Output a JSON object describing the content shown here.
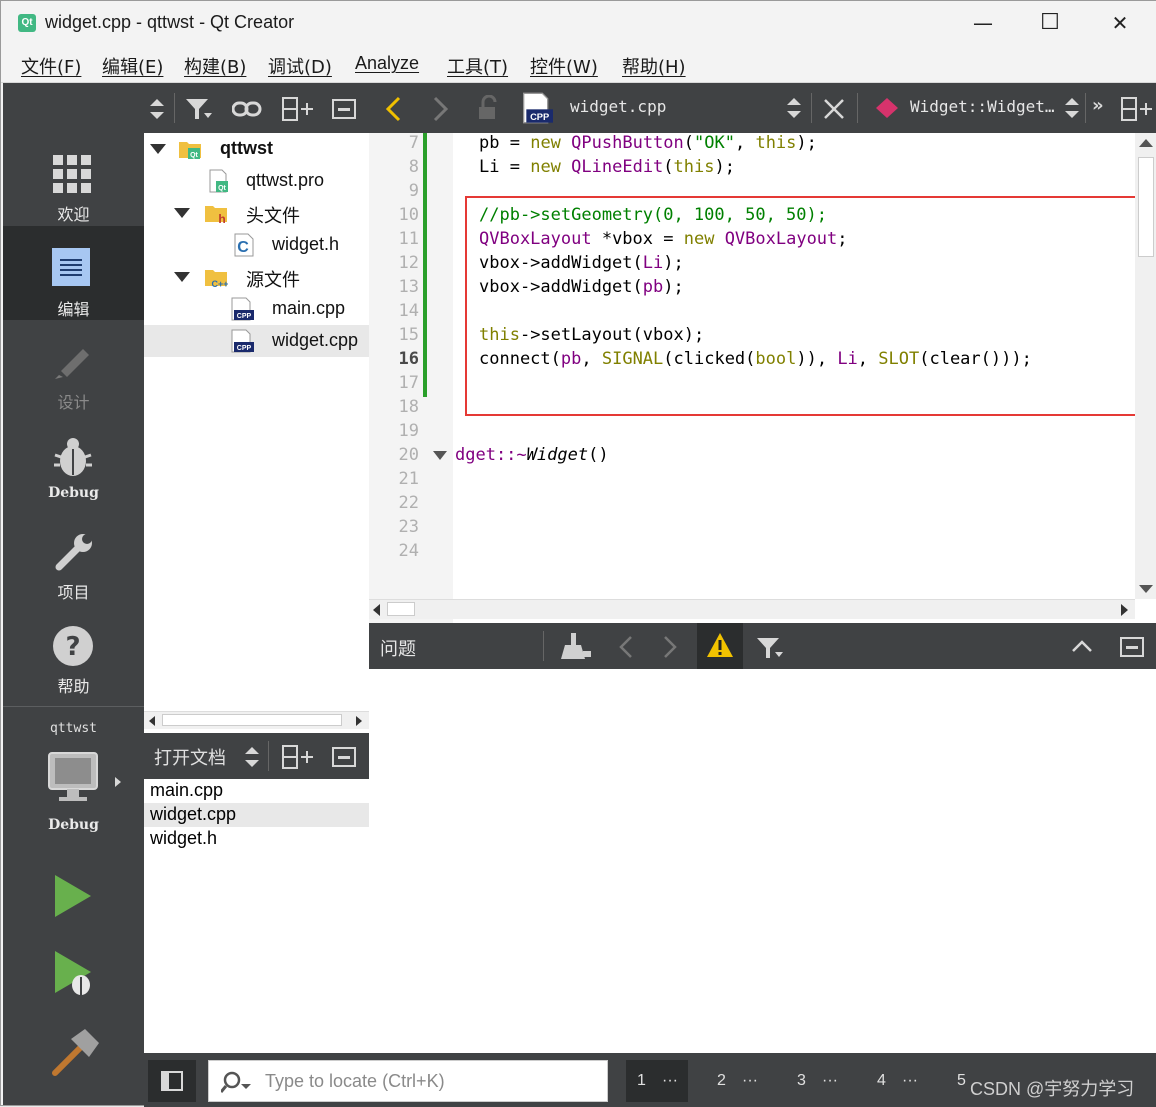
{
  "window": {
    "title": "widget.cpp - qttwst - Qt Creator",
    "app_icon_text": "Qt",
    "minimize": "—",
    "maximize": "☐",
    "close": "✕"
  },
  "menu": [
    "文件(F)",
    "编辑(E)",
    "构建(B)",
    "调试(D)",
    "Analyze",
    "工具(T)",
    "控件(W)",
    "帮助(H)"
  ],
  "modes": [
    {
      "label": "欢迎",
      "icon": "grid-icon",
      "state": "normal"
    },
    {
      "label": "编辑",
      "icon": "edit-doc-icon",
      "state": "active"
    },
    {
      "label": "设计",
      "icon": "pencil-icon",
      "state": "disabled"
    },
    {
      "label": "Debug",
      "icon": "bug-icon",
      "state": "normal"
    },
    {
      "label": "项目",
      "icon": "wrench-icon",
      "state": "normal"
    },
    {
      "label": "帮助",
      "icon": "help-icon",
      "state": "normal"
    }
  ],
  "kit": {
    "project": "qttwst",
    "config": "Debug"
  },
  "project_tree": [
    {
      "label": "qttwst",
      "kind": "project",
      "bold": true
    },
    {
      "label": "qttwst.pro",
      "kind": "pro-file"
    },
    {
      "label": "头文件",
      "kind": "header-folder"
    },
    {
      "label": "widget.h",
      "kind": "header-file"
    },
    {
      "label": "源文件",
      "kind": "source-folder"
    },
    {
      "label": "main.cpp",
      "kind": "cpp-file"
    },
    {
      "label": "widget.cpp",
      "kind": "cpp-file",
      "selected": true
    }
  ],
  "open_docs": {
    "title": "打开文档",
    "items": [
      "main.cpp",
      "widget.cpp",
      "widget.h"
    ],
    "selected": "widget.cpp"
  },
  "editor": {
    "file_name": "widget.cpp",
    "file_badge": "CPP",
    "symbol": "Widget::Widget…",
    "current_line": "16",
    "line_numbers": [
      "7",
      "8",
      "9",
      "10",
      "11",
      "12",
      "13",
      "14",
      "15",
      "16",
      "17",
      "18",
      "19",
      "20",
      "21",
      "22",
      "23",
      "24"
    ],
    "code": {
      "l7": [
        "pb",
        " = ",
        "new",
        " ",
        "QPushButton",
        "(",
        "\"OK\"",
        ", ",
        "this",
        ");"
      ],
      "l8": [
        "Li",
        " = ",
        "new",
        " ",
        "QLineEdit",
        "(",
        "this",
        ");"
      ],
      "l10": "//pb->setGeometry(0, 100, 50, 50);",
      "l11": [
        "QVBoxLayout",
        " *vbox = ",
        "new",
        " ",
        "QVBoxLayout",
        ";"
      ],
      "l12": [
        "vbox->addWidget(",
        "Li",
        ");"
      ],
      "l13": [
        "vbox->addWidget(",
        "pb",
        ");"
      ],
      "l15": [
        "this",
        "->setLayout(vbox);"
      ],
      "l16": [
        "connect(",
        "pb",
        ", ",
        "SIGNAL",
        "(clicked(",
        "bool",
        ")), ",
        "Li",
        ", ",
        "SLOT",
        "(clear()));"
      ],
      "l20": [
        "dget::~",
        "Widget",
        "()"
      ]
    }
  },
  "issues": {
    "title": "问题"
  },
  "statusbar": {
    "locator_placeholder": "Type to locate (Ctrl+K)",
    "tabs": [
      "1",
      "2",
      "3",
      "4",
      "5"
    ],
    "more": "···",
    "watermark": "CSDN @宇努力学习"
  }
}
